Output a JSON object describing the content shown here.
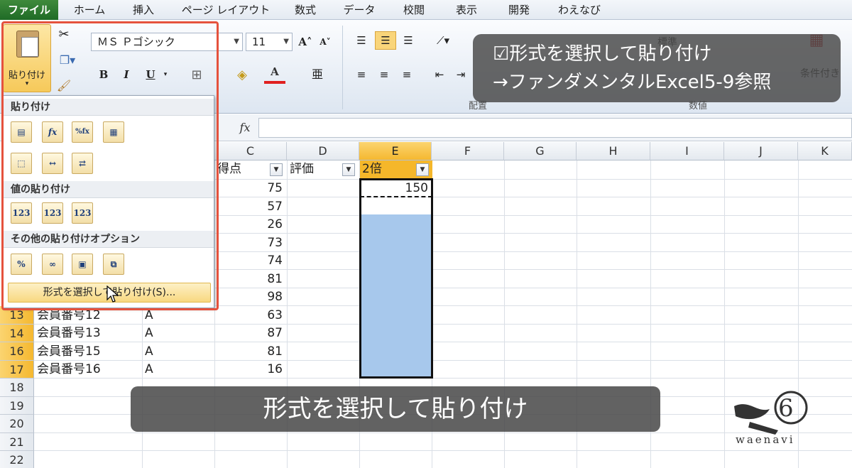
{
  "ribbon_tabs": [
    "ファイル",
    "ホーム",
    "挿入",
    "ページ レイアウト",
    "数式",
    "データ",
    "校閲",
    "表示",
    "開発",
    "わえなび"
  ],
  "clipboard": {
    "paste_label": "貼り付け"
  },
  "font": {
    "name": "ＭＳ Ｐゴシック",
    "size": "11"
  },
  "format_buttons": {
    "bold": "B",
    "italic": "I",
    "underline": "U"
  },
  "ribbon_groups": {
    "alignment": "配置",
    "number": "数値"
  },
  "ribbon_partial": {
    "number_format": "標準",
    "conditional": "条件付き"
  },
  "formula_bar": {
    "fx": "fx"
  },
  "columns": [
    "C",
    "D",
    "E",
    "F",
    "G",
    "H",
    "I",
    "J",
    "K"
  ],
  "header_row": {
    "c": "得点",
    "d": "評価",
    "e": "2倍"
  },
  "e2_value": "150",
  "scores_c": [
    "75",
    "57",
    "26",
    "73",
    "74",
    "81",
    "98"
  ],
  "rows_visible": [
    {
      "row": "13",
      "a": "会員番号12",
      "b": "A",
      "c": "63"
    },
    {
      "row": "14",
      "a": "会員番号13",
      "b": "A",
      "c": "87"
    },
    {
      "row": "16",
      "a": "会員番号15",
      "b": "A",
      "c": "81"
    },
    {
      "row": "17",
      "a": "会員番号16",
      "b": "A",
      "c": "16"
    }
  ],
  "empty_rows": [
    "18",
    "19",
    "20",
    "21",
    "22"
  ],
  "paste_menu": {
    "section_paste": "貼り付け",
    "section_values": "値の貼り付け",
    "section_other": "その他の貼り付けオプション",
    "paste_special": "形式を選択して貼り付け(S)...",
    "value_icons": [
      "123",
      "123",
      "123"
    ]
  },
  "note": {
    "line1": "☑形式を選択して貼り付け",
    "line2": "→ファンダメンタルExcel5-9参照"
  },
  "caption": "形式を選択して貼り付け",
  "logo_text": "waenavi",
  "colors": {
    "file_tab": "#2a7a2e",
    "selection": "#a7c8ec",
    "highlight_box": "#e5523d",
    "active_header": "#f5b72a"
  }
}
